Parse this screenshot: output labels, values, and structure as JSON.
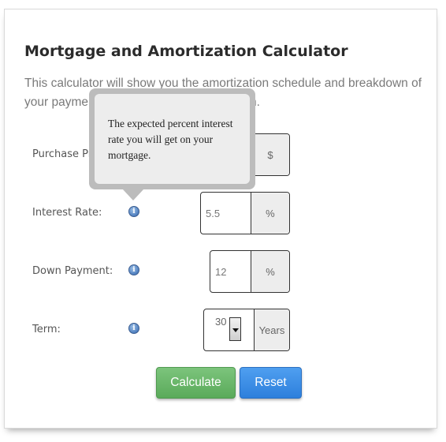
{
  "title": "Mortgage and Amortization Calculator",
  "intro": {
    "line1": "This calculator will show you the amortization schedule and breakdown of",
    "line2_start": "your payment",
    "line2_end": "n."
  },
  "fields": {
    "purchase_price": {
      "label": "Purchase Pri",
      "value": "",
      "unit": "$"
    },
    "interest_rate": {
      "label": "Interest Rate:",
      "value": "5.5",
      "unit": "%"
    },
    "down_payment": {
      "label": "Down Payment:",
      "value": "12",
      "unit": "%"
    },
    "term": {
      "label": "Term:",
      "value": "30",
      "unit": "Years"
    }
  },
  "info_icon_glyph": "i",
  "tooltip": {
    "text": "The expected percent interest rate you will get on your mortgage."
  },
  "buttons": {
    "calculate": "Calculate",
    "reset": "Reset"
  },
  "colors": {
    "calculate": "#5aaa5a",
    "reset": "#2d7fdc",
    "info_icon": "#4f7fbf"
  }
}
